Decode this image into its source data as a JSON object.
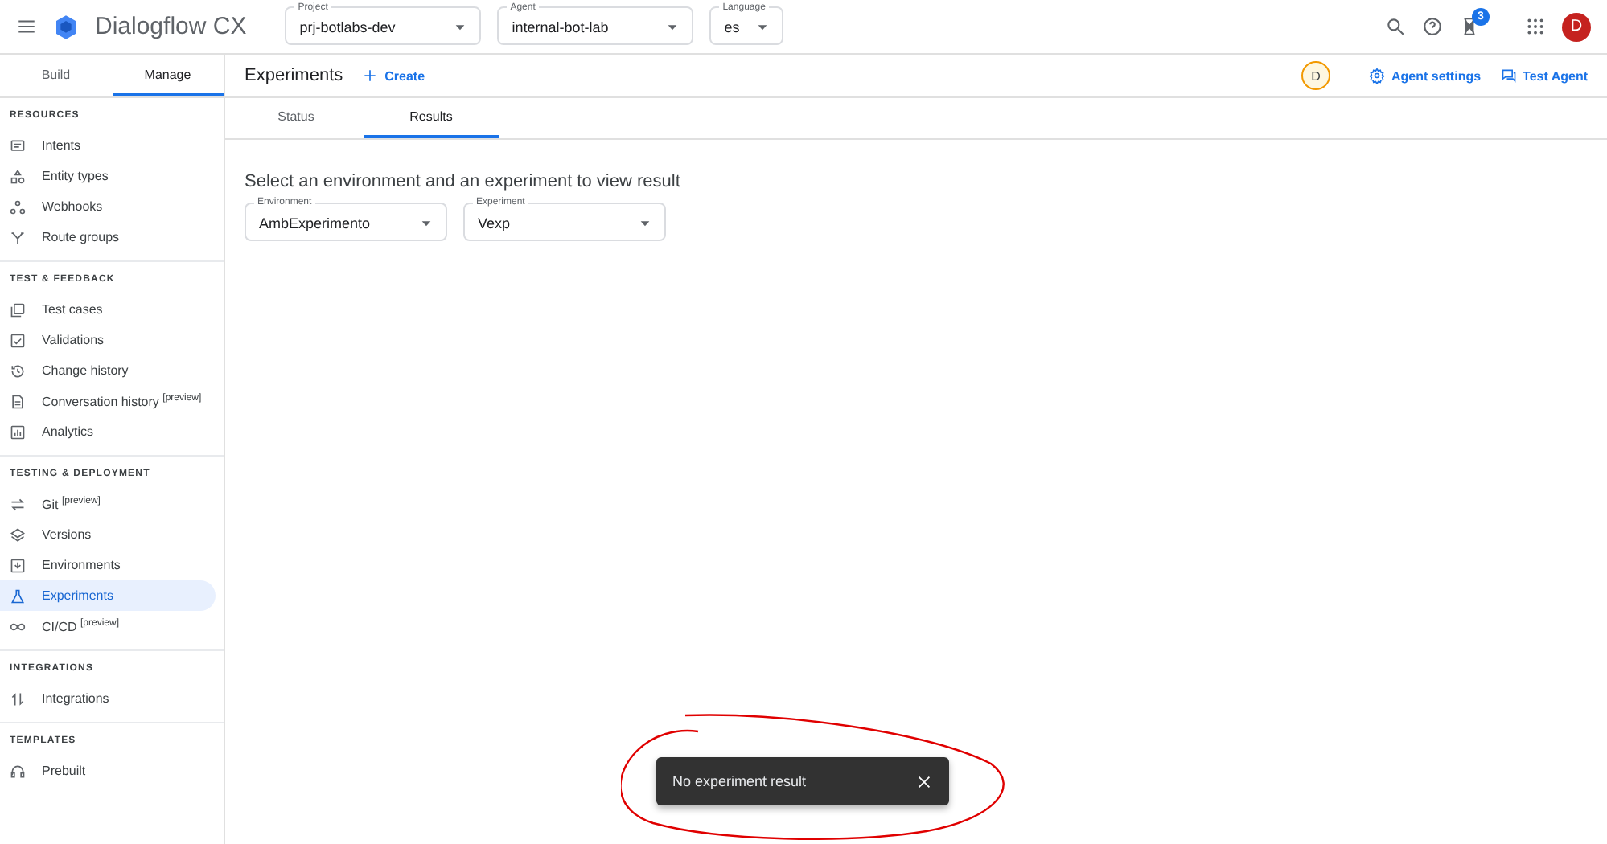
{
  "topbar": {
    "title": "Dialogflow CX",
    "selectors": [
      {
        "label": "Project",
        "value": "prj-botlabs-dev"
      },
      {
        "label": "Agent",
        "value": "internal-bot-lab"
      },
      {
        "label": "Language",
        "value": "es"
      }
    ],
    "notification_count": "3",
    "avatar": "D"
  },
  "sidebar": {
    "tabs": [
      {
        "label": "Build",
        "selected": false
      },
      {
        "label": "Manage",
        "selected": true
      }
    ],
    "sections": [
      {
        "title": "RESOURCES",
        "items": [
          {
            "label": "Intents",
            "selected": false
          },
          {
            "label": "Entity types",
            "selected": false
          },
          {
            "label": "Webhooks",
            "selected": false
          },
          {
            "label": "Route groups",
            "selected": false
          }
        ]
      },
      {
        "title": "TEST & FEEDBACK",
        "items": [
          {
            "label": "Test cases",
            "selected": false
          },
          {
            "label": "Validations",
            "selected": false
          },
          {
            "label": "Change history",
            "selected": false
          },
          {
            "label": "Conversation history $^{[preview]}$",
            "selected": false
          },
          {
            "label": "Analytics",
            "selected": false
          }
        ]
      },
      {
        "title": "TESTING & DEPLOYMENT",
        "items": [
          {
            "label": "Git $^{[preview]}$",
            "selected": false
          },
          {
            "label": "Versions",
            "selected": false
          },
          {
            "label": "Environments",
            "selected": false
          },
          {
            "label": "Experiments",
            "selected": true
          },
          {
            "label": "CI/CD $^{[preview]}$",
            "selected": false
          }
        ]
      },
      {
        "title": "INTEGRATIONS",
        "items": [
          {
            "label": "Integrations",
            "selected": false
          }
        ]
      },
      {
        "title": "TEMPLATES",
        "items": [
          {
            "label": "Prebuilt",
            "selected": false
          }
        ]
      }
    ]
  },
  "header": {
    "title": "Experiments",
    "create": "Create",
    "user_badge": "D",
    "actions": [
      "Agent settings",
      "Test Agent"
    ]
  },
  "tabs": [
    {
      "label": "Status",
      "selected": false
    },
    {
      "label": "Results",
      "selected": true
    }
  ],
  "prompt": "Select an environment and an experiment to view result",
  "fields": [
    {
      "label": "Environment",
      "value": "AmbExperimento"
    },
    {
      "label": "Experiment",
      "value": "Vexp"
    }
  ],
  "snackbar": {
    "message": "No experiment result"
  }
}
